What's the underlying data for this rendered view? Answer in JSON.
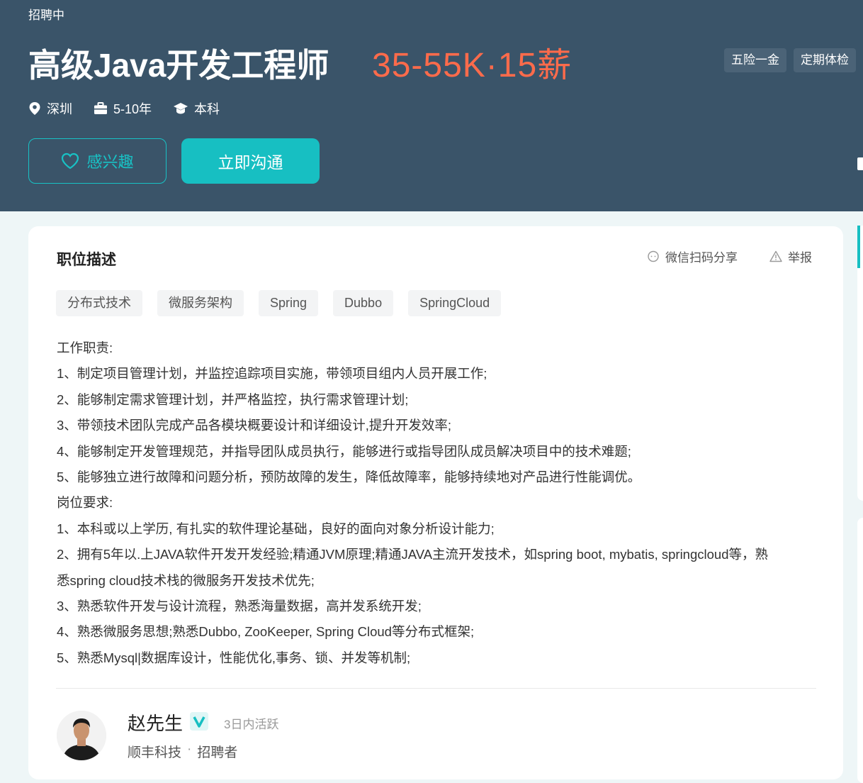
{
  "header": {
    "status": "招聘中",
    "job_title": "高级Java开发工程师",
    "salary": "35-55K·15薪",
    "benefits": [
      "五险一金",
      "定期体检"
    ],
    "meta": {
      "location": "深圳",
      "experience": "5-10年",
      "education": "本科"
    },
    "buttons": {
      "interest_label": "感兴趣",
      "chat_label": "立即沟通"
    }
  },
  "card": {
    "section_title": "职位描述",
    "share_label": "微信扫码分享",
    "report_label": "举报",
    "skills": [
      "分布式技术",
      "微服务架构",
      "Spring",
      "Dubbo",
      "SpringCloud"
    ],
    "description_lines": [
      "工作职责:",
      "1、制定项目管理计划，并监控追踪项目实施，带领项目组内人员开展工作;",
      "2、能够制定需求管理计划，并严格监控，执行需求管理计划;",
      "3、带领技术团队完成产品各模块概要设计和详细设计,提升开发效率;",
      "4、能够制定开发管理规范，并指导团队成员执行，能够进行或指导团队成员解决项目中的技术难题;",
      "5、能够独立进行故障和问题分析，预防故障的发生，降低故障率，能够持续地对产品进行性能调优。",
      "岗位要求:",
      "1、本科或以上学历, 有扎实的软件理论基础，良好的面向对象分析设计能力;",
      "2、拥有5年以.上JAVA软件开发开发经验;精通JVM原理;精通JAVA主流开发技术，如spring boot, mybatis, springcloud等，熟",
      "悉spring cloud技术栈的微服务开发技术优先;",
      "3、熟悉软件开发与设计流程，熟悉海量数据，高并发系统开发;",
      "4、熟悉微服务思想;熟悉Dubbo, ZooKeeper, Spring Cloud等分布式框架;",
      "5、熟悉Mysql|数据库设计，性能优化,事务、锁、并发等机制;"
    ],
    "recruiter": {
      "name": "赵先生",
      "active": "3日内活跃",
      "company": "顺丰科技",
      "role": "招聘者"
    }
  },
  "colors": {
    "header_bg": "#3a5469",
    "accent": "#17bfc2",
    "salary": "#fe6b4b"
  }
}
